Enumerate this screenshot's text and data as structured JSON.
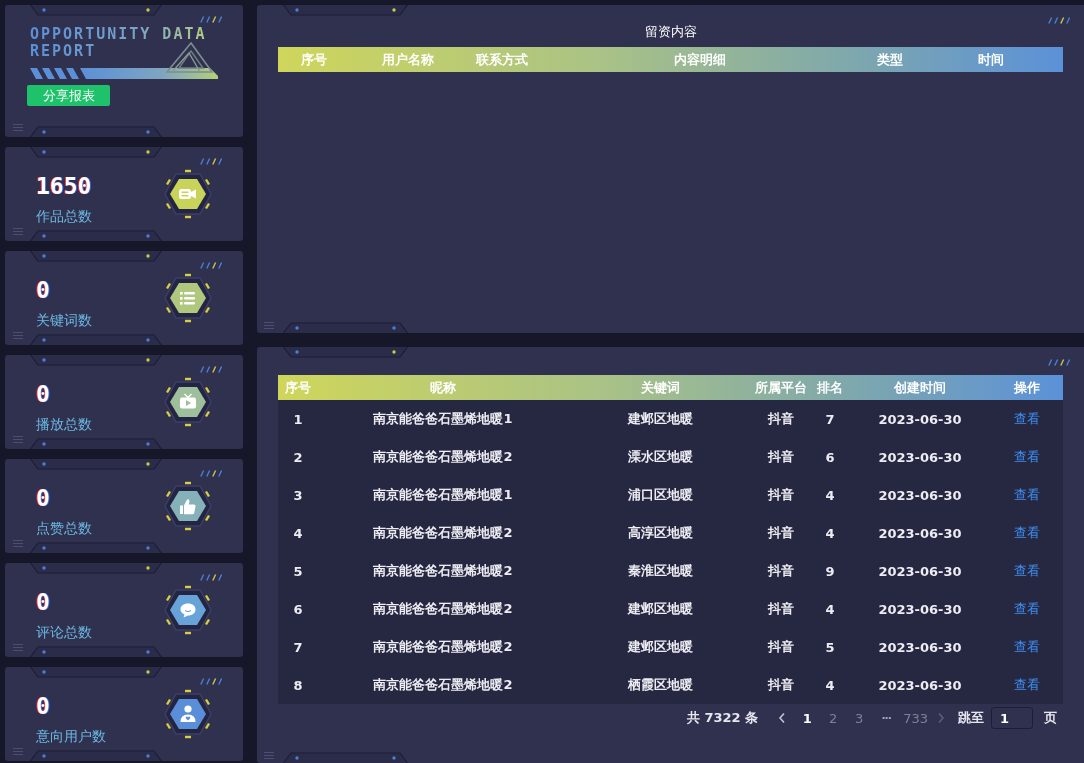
{
  "logo": {
    "title_lines": [
      "OPPORTUNITY DATA",
      "REPORT"
    ],
    "share_button": "分享报表"
  },
  "stats": [
    {
      "value": "1650",
      "label": "作品总数",
      "color": "#c8d35a"
    },
    {
      "value": "0",
      "label": "关键词数",
      "color": "#b0c77e"
    },
    {
      "value": "0",
      "label": "播放总数",
      "color": "#9dbf9c"
    },
    {
      "value": "0",
      "label": "点赞总数",
      "color": "#84b2b8"
    },
    {
      "value": "0",
      "label": "评论总数",
      "color": "#67a3d8"
    },
    {
      "value": "0",
      "label": "意向用户数",
      "color": "#5a8ed8"
    }
  ],
  "leads_panel": {
    "title": "留资内容",
    "columns": [
      "序号",
      "用户名称",
      "联系方式",
      "内容明细",
      "类型",
      "时间"
    ]
  },
  "ranking_table": {
    "columns": [
      "序号",
      "昵称",
      "关键词",
      "所属平台",
      "排名",
      "创建时间",
      "操作"
    ],
    "rows": [
      {
        "index": "1",
        "nickname": "南京能爸爸石墨烯地暖1",
        "keyword": "建邺区地暖",
        "platform": "抖音",
        "rank": "7",
        "created": "2023-06-30",
        "action": "查看"
      },
      {
        "index": "2",
        "nickname": "南京能爸爸石墨烯地暖2",
        "keyword": "溧水区地暖",
        "platform": "抖音",
        "rank": "6",
        "created": "2023-06-30",
        "action": "查看"
      },
      {
        "index": "3",
        "nickname": "南京能爸爸石墨烯地暖1",
        "keyword": "浦口区地暖",
        "platform": "抖音",
        "rank": "4",
        "created": "2023-06-30",
        "action": "查看"
      },
      {
        "index": "4",
        "nickname": "南京能爸爸石墨烯地暖2",
        "keyword": "高淳区地暖",
        "platform": "抖音",
        "rank": "4",
        "created": "2023-06-30",
        "action": "查看"
      },
      {
        "index": "5",
        "nickname": "南京能爸爸石墨烯地暖2",
        "keyword": "秦淮区地暖",
        "platform": "抖音",
        "rank": "9",
        "created": "2023-06-30",
        "action": "查看"
      },
      {
        "index": "6",
        "nickname": "南京能爸爸石墨烯地暖2",
        "keyword": "建邺区地暖",
        "platform": "抖音",
        "rank": "4",
        "created": "2023-06-30",
        "action": "查看"
      },
      {
        "index": "7",
        "nickname": "南京能爸爸石墨烯地暖2",
        "keyword": "建邺区地暖",
        "platform": "抖音",
        "rank": "5",
        "created": "2023-06-30",
        "action": "查看"
      },
      {
        "index": "8",
        "nickname": "南京能爸爸石墨烯地暖2",
        "keyword": "栖霞区地暖",
        "platform": "抖音",
        "rank": "4",
        "created": "2023-06-30",
        "action": "查看"
      }
    ]
  },
  "pagination": {
    "total": "共 7322 条",
    "pages": [
      {
        "kind": "page",
        "label": "1",
        "selected": true
      },
      {
        "kind": "page",
        "label": "2",
        "selected": false
      },
      {
        "kind": "page",
        "label": "3",
        "selected": false
      },
      {
        "kind": "ellipsis",
        "label": "···",
        "selected": false
      },
      {
        "kind": "page",
        "label": "733",
        "selected": false
      }
    ],
    "jump_label": "跳至",
    "jump_value": "1",
    "page_suffix": "页"
  }
}
